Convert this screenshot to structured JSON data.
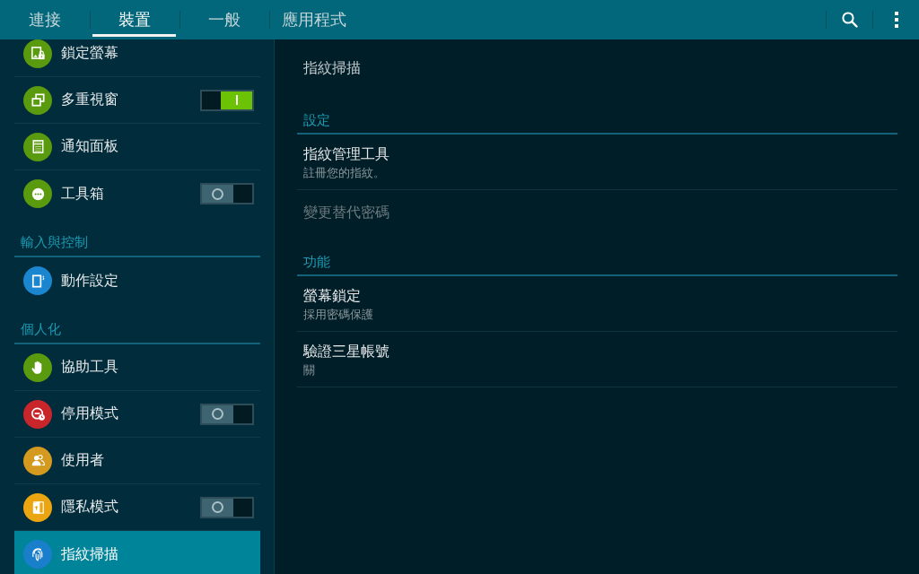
{
  "tabs": [
    {
      "label": "連接",
      "selected": false
    },
    {
      "label": "裝置",
      "selected": true
    },
    {
      "label": "一般",
      "selected": false
    },
    {
      "label": "應用程式",
      "selected": false
    }
  ],
  "sidebar": {
    "items": [
      {
        "kind": "setting",
        "label": "鎖定螢幕",
        "color": "#5a9a0e",
        "selected": false
      },
      {
        "kind": "switch",
        "label": "多重視窗",
        "color": "#5a9a0e",
        "selected": false,
        "on": true
      },
      {
        "kind": "setting",
        "label": "通知面板",
        "color": "#5a9a0e",
        "selected": false
      },
      {
        "kind": "switch",
        "label": "工具箱",
        "color": "#5a9a0e",
        "selected": false,
        "on": false
      },
      {
        "kind": "section",
        "label": "輸入與控制"
      },
      {
        "kind": "setting",
        "label": "動作設定",
        "color": "#1a86cf",
        "selected": false
      },
      {
        "kind": "section",
        "label": "個人化"
      },
      {
        "kind": "setting",
        "label": "協助工具",
        "color": "#5a9a0e",
        "selected": false
      },
      {
        "kind": "switch",
        "label": "停用模式",
        "color": "#c8262b",
        "selected": false,
        "on": false
      },
      {
        "kind": "setting",
        "label": "使用者",
        "color": "#d4991f",
        "selected": false
      },
      {
        "kind": "switch",
        "label": "隱私模式",
        "color": "#eba511",
        "selected": false,
        "on": false
      },
      {
        "kind": "setting",
        "label": "指紋掃描",
        "color": "#1a7fcb",
        "selected": true
      }
    ]
  },
  "detail": {
    "title": "指紋掃描",
    "sections": [
      {
        "header": "設定",
        "items": [
          {
            "title": "指紋管理工具",
            "subtitle": "註冊您的指紋。",
            "disabled": false
          },
          {
            "title": "變更替代密碼",
            "disabled": true
          }
        ]
      },
      {
        "header": "功能",
        "items": [
          {
            "title": "螢幕鎖定",
            "subtitle": "採用密碼保護",
            "disabled": false
          },
          {
            "title": "驗證三星帳號",
            "subtitle": "關",
            "disabled": false
          }
        ]
      }
    ]
  }
}
